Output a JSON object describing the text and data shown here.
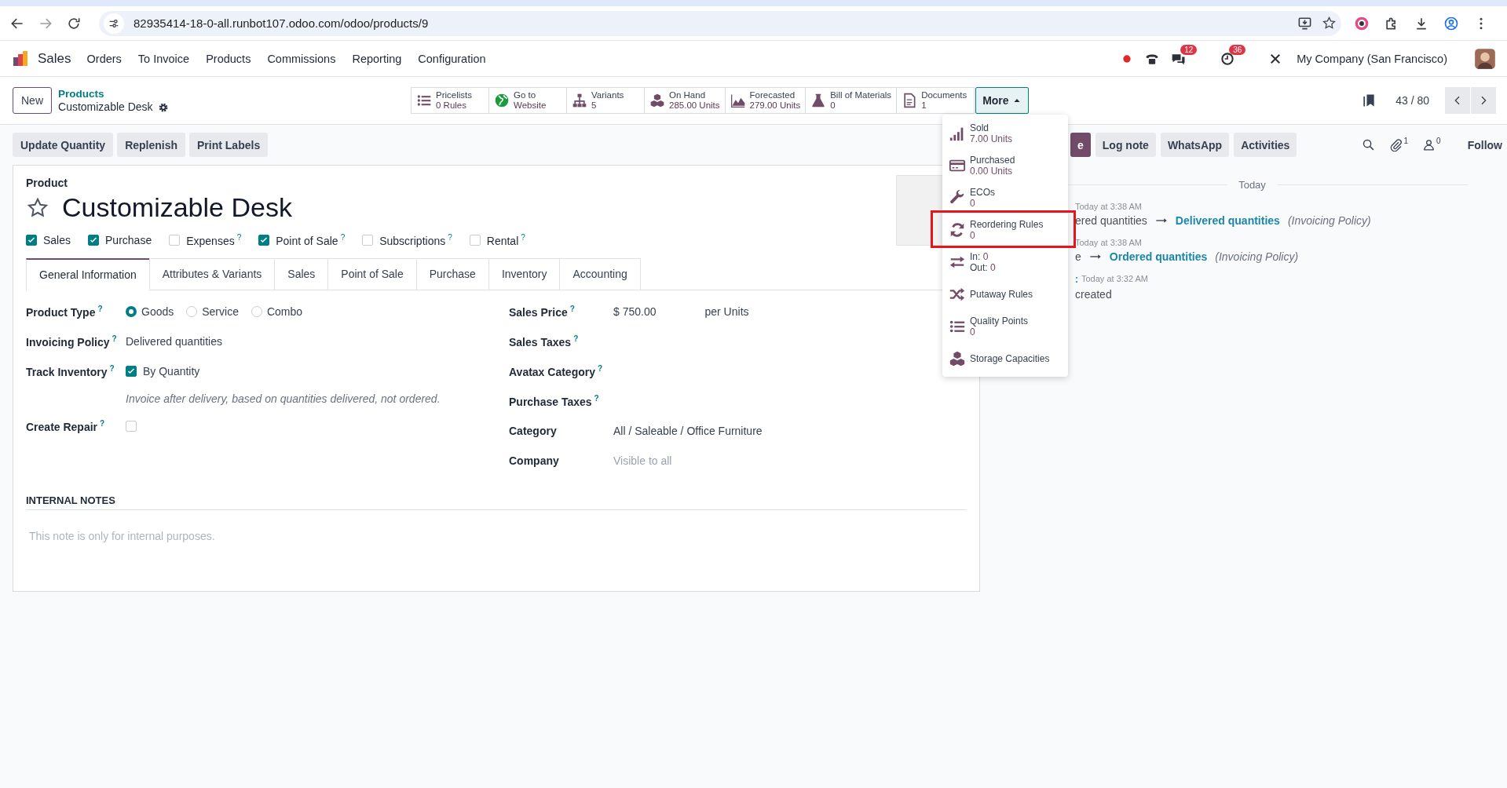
{
  "browser": {
    "url": "82935414-18-0-all.runbot107.odoo.com/odoo/products/9"
  },
  "navbar": {
    "app": "Sales",
    "menus": [
      "Orders",
      "To Invoice",
      "Products",
      "Commissions",
      "Reporting",
      "Configuration"
    ],
    "message_count": "12",
    "activity_count": "36",
    "company": "My Company (San Francisco)"
  },
  "control_panel": {
    "new_button": "New",
    "breadcrumb": "Products",
    "record_name": "Customizable Desk",
    "smart_buttons": [
      {
        "label": "Pricelists",
        "value": "0 Rules"
      },
      {
        "label": "Go to",
        "value": "Website"
      },
      {
        "label": "Variants",
        "value": "5"
      },
      {
        "label": "On Hand",
        "value": "285.00 Units"
      },
      {
        "label": "Forecasted",
        "value": "279.00 Units"
      },
      {
        "label": "Bill of Materials",
        "value": "0"
      },
      {
        "label": "Documents",
        "value": "1"
      }
    ],
    "more_button": {
      "label": "More",
      "expanded": true
    },
    "pager": "43 / 80"
  },
  "more_menu": [
    {
      "kind": "stat",
      "label": "Sold",
      "value": "7.00 Units",
      "highlighted": false
    },
    {
      "kind": "stat",
      "label": "Purchased",
      "value": "0.00 Units",
      "highlighted": false
    },
    {
      "kind": "stat",
      "label": "ECOs",
      "value": "0",
      "highlighted": false
    },
    {
      "kind": "stat",
      "label": "Reordering Rules",
      "value": "0",
      "highlighted": true
    },
    {
      "kind": "in_out",
      "lines": [
        {
          "label": "In:",
          "value": "0"
        },
        {
          "label": "Out:",
          "value": "0"
        }
      ],
      "highlighted": false
    },
    {
      "kind": "stat",
      "label": "Putaway Rules",
      "highlighted": false
    },
    {
      "kind": "stat",
      "label": "Quality Points",
      "value": "0",
      "highlighted": false
    },
    {
      "kind": "stat",
      "label": "Storage Capacities",
      "highlighted": false
    }
  ],
  "actions": [
    "Update Quantity",
    "Replenish",
    "Print Labels"
  ],
  "form": {
    "title_label": "Product",
    "name": "Customizable Desk",
    "favorite": false,
    "options": [
      {
        "label": "Sales",
        "checked": true
      },
      {
        "label": "Purchase",
        "checked": true
      },
      {
        "label": "Expenses",
        "checked": false,
        "help": "?"
      },
      {
        "label": "Point of Sale",
        "checked": true,
        "help": "?"
      },
      {
        "label": "Subscriptions",
        "checked": false,
        "help": "?"
      },
      {
        "label": "Rental",
        "checked": false,
        "help": "?"
      }
    ],
    "tabs": [
      {
        "label": "General Information",
        "selected": true
      },
      {
        "label": "Attributes & Variants",
        "selected": false
      },
      {
        "label": "Sales",
        "selected": false
      },
      {
        "label": "Point of Sale",
        "selected": false
      },
      {
        "label": "Purchase",
        "selected": false
      },
      {
        "label": "Inventory",
        "selected": false
      },
      {
        "label": "Accounting",
        "selected": false
      }
    ],
    "left_fields": [
      {
        "kind": "radio",
        "label": "Product Type",
        "help": "?",
        "options": [
          {
            "label": "Goods",
            "selected": true
          },
          {
            "label": "Service",
            "selected": false
          },
          {
            "label": "Combo",
            "selected": false
          }
        ]
      },
      {
        "kind": "text",
        "label": "Invoicing Policy",
        "help": "?",
        "value": "Delivered quantities"
      },
      {
        "kind": "checkbox",
        "label": "Track Inventory",
        "help": "?",
        "checked": true,
        "text": "By Quantity",
        "note": "Invoice after delivery, based on quantities delivered, not ordered."
      },
      {
        "kind": "checkbox",
        "label": "Create Repair",
        "help": "?",
        "checked": false
      }
    ],
    "right_fields": [
      {
        "kind": "price",
        "label": "Sales Price",
        "help": "?",
        "value": "$ 750.00",
        "unit": "per Units"
      },
      {
        "kind": "text",
        "label": "Sales Taxes",
        "help": "?"
      },
      {
        "kind": "text",
        "label": "Avatax Category",
        "help": "?"
      },
      {
        "kind": "text",
        "label": "Purchase Taxes",
        "help": "?"
      },
      {
        "kind": "text",
        "label": "Category",
        "value": "All / Saleable / Office Furniture"
      },
      {
        "kind": "text",
        "label": "Company",
        "placeholder": "Visible to all"
      }
    ],
    "notes": {
      "title": "INTERNAL NOTES",
      "placeholder": "This note is only for internal purposes."
    }
  },
  "chatter": {
    "buttons": [
      {
        "label": "e",
        "primary": true
      },
      {
        "label": "Log note",
        "primary": false
      },
      {
        "label": "WhatsApp",
        "primary": false
      },
      {
        "label": "Activities",
        "primary": false
      }
    ],
    "attachment_count": "1",
    "follower_count": "0",
    "follow": "Follow",
    "date": "Today",
    "messages": [
      {
        "kind": "tracking",
        "time": "Today at 3:38 AM",
        "old_value": "ered quantities",
        "new_value": "Delivered quantities",
        "field": "(Invoicing Policy)"
      },
      {
        "kind": "tracking",
        "time": "Today at 3:38 AM",
        "old_value": "e",
        "new_value": "Ordered quantities",
        "field": "(Invoicing Policy)"
      },
      {
        "kind": "note",
        "author": ":",
        "time": "Today at 3:32 AM",
        "body": "created"
      }
    ]
  }
}
